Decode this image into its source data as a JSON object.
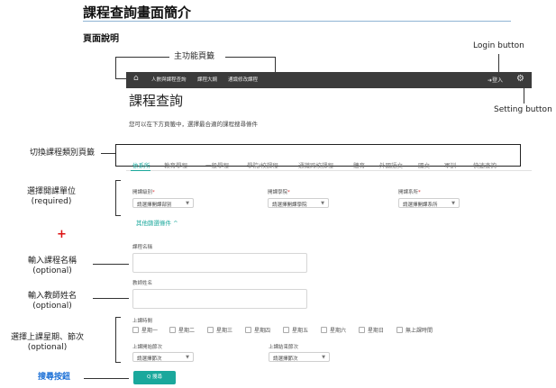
{
  "doc": {
    "title": "課程查詢畫面簡介",
    "subtitle": "頁面說明"
  },
  "annotations": {
    "main_nav": "主功能頁籤",
    "login": "Login button",
    "setting": "Setting button",
    "switch_tabs": "切換課程類別頁籤",
    "unit_line1": "選擇開課單位",
    "unit_line2": "(required)",
    "plus": "+",
    "course_name_line1": "輸入課程名稱",
    "course_name_line2": "(optional)",
    "teacher_line1": "輸入教師姓名",
    "teacher_line2": "(optional)",
    "time_line1": "選擇上課星期、節次",
    "time_line2": "(optional)",
    "search_btn": "搜尋按鈕"
  },
  "navbar": {
    "items": [
      "人數與課程查詢",
      "課程大綱",
      "通識修改課程"
    ],
    "login_label": "登入"
  },
  "page": {
    "heading": "課程查詢",
    "intro": "您可以在下方頁籤中，選擇最合適的課程搜尋條件"
  },
  "tabs": [
    "依系所",
    "教育學程",
    "一般學程",
    "學院/校課程",
    "通識跨校課程",
    "體育",
    "外國語文",
    "國文",
    "軍訓",
    "快速查詢"
  ],
  "filters": {
    "level_label": "開課級別",
    "level_value": "請選擇開課部別",
    "college_label": "開課學院",
    "college_value": "請選擇開課學院",
    "dept_label": "開課系所",
    "dept_value": "請選擇開課系所",
    "required_mark": "*",
    "more_filter": "其他篩選條件 ^"
  },
  "course_name_label": "課程名稱",
  "teacher_label": "教師姓名",
  "time": {
    "label": "上課時間",
    "days": [
      "星期一",
      "星期二",
      "星期三",
      "星期四",
      "星期五",
      "星期六",
      "星期日",
      "無上課時間"
    ],
    "start_label": "上課開始節次",
    "start_value": "請選擇節次",
    "end_label": "上課結束節次",
    "end_value": "請選擇節次"
  },
  "search_button": "Q 搜尋"
}
